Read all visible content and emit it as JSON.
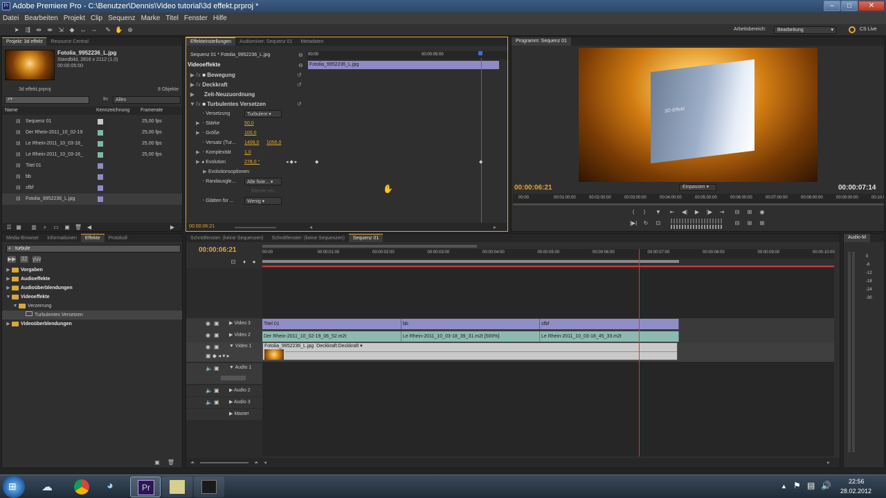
{
  "window": {
    "title": "Adobe Premiere Pro - C:\\Benutzer\\Dennis\\Video tutorial\\3d effekt.prproj *"
  },
  "menu": [
    "Datei",
    "Bearbeiten",
    "Projekt",
    "Clip",
    "Sequenz",
    "Marke",
    "Titel",
    "Fenster",
    "Hilfe"
  ],
  "workspace": {
    "label": "Arbeitsbereich:",
    "value": "Bearbeitung",
    "cs_live": "CS Live"
  },
  "project": {
    "tabs": [
      "Projekt: 3d effekt",
      "Resource Central"
    ],
    "preview_name": "Fotolia_9952236_L.jpg",
    "preview_info1": "Standbild, 2816 x 2112 (1,0)",
    "preview_info2": "00:00:05:00",
    "project_file": "3d effekt.prproj",
    "count": "8 Objekte",
    "in_label": "In:",
    "in_value": "Alles",
    "columns": [
      "Name",
      "Kennzeichnung",
      "Framerate"
    ],
    "items": [
      {
        "name": "Sequenz 01",
        "fps": "25,00 fps",
        "color": "#c8c8c8"
      },
      {
        "name": "Der Rhein-2011_10_02-19",
        "fps": "25,00 fps",
        "color": "#7fb7a8"
      },
      {
        "name": "Le Rhein-2011_10_03-18_",
        "fps": "25,00 fps",
        "color": "#7fb7a8"
      },
      {
        "name": "Le Rhein-2011_10_03-18_",
        "fps": "25,00 fps",
        "color": "#7fb7a8"
      },
      {
        "name": "Titel 01",
        "fps": "",
        "color": "#8e8bc6"
      },
      {
        "name": "bb",
        "fps": "",
        "color": "#8e8bc6"
      },
      {
        "name": "sfbf",
        "fps": "",
        "color": "#8e8bc6"
      },
      {
        "name": "Fotolia_9952236_L.jpg",
        "fps": "",
        "color": "#8e8bc6"
      }
    ]
  },
  "effects_panel": {
    "tabs": [
      "Effekteinstellungen",
      "Audiomixer: Sequenz 01",
      "Metadaten"
    ],
    "clip_label": "Sequenz 01 * Fotolia_9952236_L.jpg",
    "timecodes": [
      "00:00",
      "00:00:05:00"
    ],
    "clip_bar": "Fotolia_9952236_L.jpg",
    "section": "Videoeffekte",
    "effects": [
      "Bewegung",
      "Deckkraft",
      "Zeit-Neuzuordnung",
      "Turbulentes Versetzen"
    ],
    "params": {
      "versetzung": {
        "label": "Versetzung",
        "value": "Turbulent"
      },
      "staerke": {
        "label": "Stärke",
        "value": "50,0"
      },
      "groesse": {
        "label": "Größe",
        "value": "100,0"
      },
      "versatz": {
        "label": "Versatz (Tur...",
        "value1": "1408,0",
        "value2": "1056,0"
      },
      "komplexitaet": {
        "label": "Komplexität",
        "value": "1,0"
      },
      "evolution": {
        "label": "Evolution",
        "value": "278,0 °"
      },
      "evo_options": {
        "label": "Evolutionsoptionen"
      },
      "randausgleich": {
        "label": "Randausgle...",
        "value": "Alle fixie..."
      },
      "disabled": {
        "label": "Blende ein..."
      },
      "glaetten": {
        "label": "Glätten für ...",
        "value": "Wenig"
      }
    },
    "footer_tc": "00:00:06:21"
  },
  "program": {
    "tab": "Programm: Sequenz 01",
    "overlay_text": "3D-Effekt",
    "current_tc": "00:00:06:21",
    "fit": "Einpassen",
    "duration": "00:00:07:14",
    "ruler": [
      "00:00",
      "00:01:00:00",
      "00:02:00:00",
      "00:03:00:00",
      "00:04:00:00",
      "00:05:00:00",
      "00:06:00:00",
      "00:07:00:00",
      "00:08:00:00",
      "00:09:00:00",
      "00:10:00:00"
    ]
  },
  "effects_browser": {
    "tabs": [
      "Media-Browser",
      "Informationen",
      "Effekte",
      "Protokoll"
    ],
    "search": "turbule",
    "tree": [
      {
        "label": "Vorgaben",
        "level": 0,
        "bold": true
      },
      {
        "label": "Audioeffekte",
        "level": 0,
        "bold": true
      },
      {
        "label": "Audioüberblendungen",
        "level": 0,
        "bold": true
      },
      {
        "label": "Videoeffekte",
        "level": 0,
        "bold": true,
        "open": true
      },
      {
        "label": "Verzerrung",
        "level": 1,
        "bold": false,
        "open": true
      },
      {
        "label": "Turbulentes Versetzen",
        "level": 2,
        "bold": false
      },
      {
        "label": "Videoüberblendungen",
        "level": 0,
        "bold": true
      }
    ]
  },
  "timeline": {
    "tabs": [
      "Schnittfenster: (keine Sequenzen)",
      "Schnittfenster: (keine Sequenzen)",
      "Sequenz 01"
    ],
    "current_tc": "00:00:06:21",
    "ruler": [
      "00:00",
      "00:00:01:00",
      "00:00:02:00",
      "00:00:03:00",
      "00:00:04:00",
      "00:00:05:00",
      "00:00:06:00",
      "00:00:07:00",
      "00:00:08:00",
      "00:00:09:00",
      "00:00:10:00"
    ],
    "tracks": [
      "Video 3",
      "Video 2",
      "Video 1",
      "Audio 1",
      "Audio 2",
      "Audio 3",
      "Master"
    ],
    "v3_clips": [
      "Titel 01",
      "bb",
      "sfbf"
    ],
    "v2_clips": [
      "Der Rhein-2011_10_02-19_06_52.m2t",
      "Le Rhein-2011_10_03-18_39_31.m2t [500%]",
      "Le Rhein-2011_10_03-18_45_33.m2t"
    ],
    "v1_clip": "Fotolia_9952236_L.jpg",
    "v1_opacity": "Deckkraft:Deckkraft"
  },
  "audio_meter": {
    "tab": "Audio-M",
    "scale": [
      "0",
      "-6",
      "-12",
      "-18",
      "-24",
      "-30"
    ]
  },
  "taskbar": {
    "time": "22:56",
    "date": "28.02.2012"
  },
  "colors": {
    "accent": "#e9a52f",
    "video_track": "#8f8ec9",
    "video2_track": "#8dbab0",
    "playhead": "#d23b3b"
  }
}
